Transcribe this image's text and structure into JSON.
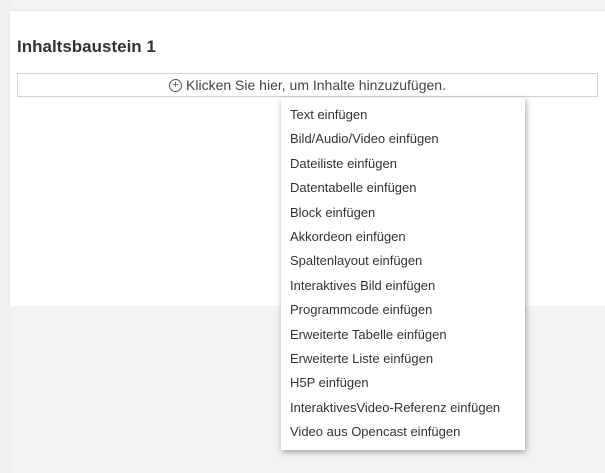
{
  "section": {
    "title": "Inhaltsbaustein 1",
    "add_prompt": "Klicken Sie hier, um Inhalte hinzuzufügen.",
    "add_icon": "plus-circle-icon"
  },
  "menu": {
    "items": [
      "Text einfügen",
      "Bild/Audio/Video einfügen",
      "Dateiliste einfügen",
      "Datentabelle einfügen",
      "Block einfügen",
      "Akkordeon einfügen",
      "Spaltenlayout einfügen",
      "Interaktives Bild einfügen",
      "Programmcode einfügen",
      "Erweiterte Tabelle einfügen",
      "Erweiterte Liste einfügen",
      "H5P einfügen",
      "InteraktivesVideo-Referenz einfügen",
      "Video aus Opencast einfügen"
    ]
  },
  "colors": {
    "background": "#f3f3f3",
    "panel": "#ffffff",
    "text": "#333333",
    "border": "#d2d2d2"
  }
}
